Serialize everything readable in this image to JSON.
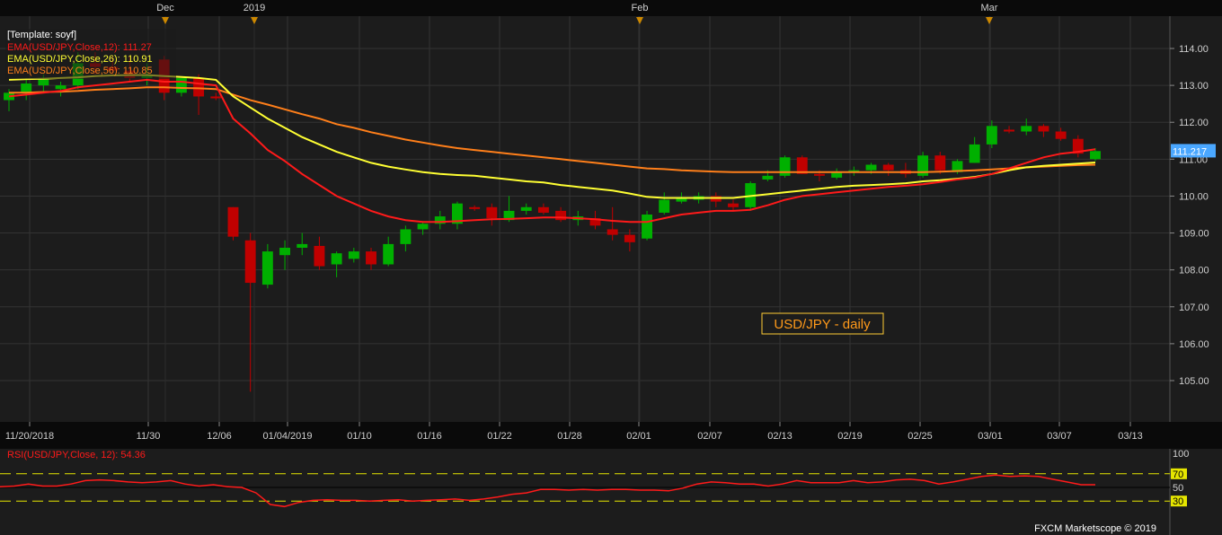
{
  "main_chart": {
    "chart_data": {
      "type": "candlestick",
      "symbol": "USD/JPY",
      "title": "USD/JPY - daily",
      "template": "[Template: soyf]",
      "price_label": "111.217",
      "ylim": [
        104.2,
        114.5
      ],
      "yticks": [
        "114.00",
        "113.00",
        "112.00",
        "111.00",
        "110.00",
        "109.00",
        "108.00",
        "107.00",
        "106.00",
        "105.00"
      ],
      "x_top_markers": [
        "Dec",
        "2019",
        "Feb",
        "Mar"
      ],
      "x_bottom_labels": [
        "11/20/2018",
        "11/30",
        "12/06",
        "01/04/2019",
        "01/10",
        "01/16",
        "01/22",
        "01/28",
        "02/01",
        "02/07",
        "02/13",
        "02/19",
        "02/25",
        "03/01",
        "03/07",
        "03/13"
      ],
      "candles": [
        {
          "o": 112.6,
          "h": 112.9,
          "l": 112.3,
          "c": 112.8
        },
        {
          "o": 112.8,
          "h": 113.2,
          "l": 112.6,
          "c": 113.05
        },
        {
          "o": 113.0,
          "h": 113.3,
          "l": 112.8,
          "c": 113.2
        },
        {
          "o": 112.9,
          "h": 113.1,
          "l": 112.7,
          "c": 113.0
        },
        {
          "o": 113.0,
          "h": 113.9,
          "l": 112.9,
          "c": 113.6
        },
        {
          "o": 113.6,
          "h": 113.9,
          "l": 113.3,
          "c": 113.5
        },
        {
          "o": 113.5,
          "h": 113.8,
          "l": 113.3,
          "c": 113.4
        },
        {
          "o": 113.4,
          "h": 113.8,
          "l": 113.1,
          "c": 113.2
        },
        {
          "o": 113.2,
          "h": 113.6,
          "l": 113.0,
          "c": 113.3
        },
        {
          "o": 113.7,
          "h": 113.8,
          "l": 112.6,
          "c": 112.8
        },
        {
          "o": 112.8,
          "h": 113.2,
          "l": 112.7,
          "c": 113.2
        },
        {
          "o": 113.2,
          "h": 113.3,
          "l": 112.2,
          "c": 112.7
        },
        {
          "o": 112.7,
          "h": 112.8,
          "l": 112.6,
          "c": 112.65
        },
        {
          "o": 109.7,
          "h": 109.7,
          "l": 108.8,
          "c": 108.9
        },
        {
          "o": 108.8,
          "h": 109.0,
          "l": 104.7,
          "c": 107.65
        },
        {
          "o": 107.6,
          "h": 108.7,
          "l": 107.5,
          "c": 108.5
        },
        {
          "o": 108.4,
          "h": 108.8,
          "l": 108.0,
          "c": 108.6
        },
        {
          "o": 108.6,
          "h": 109.0,
          "l": 108.4,
          "c": 108.7
        },
        {
          "o": 108.65,
          "h": 108.9,
          "l": 108.0,
          "c": 108.1
        },
        {
          "o": 108.15,
          "h": 108.5,
          "l": 107.8,
          "c": 108.45
        },
        {
          "o": 108.3,
          "h": 108.6,
          "l": 108.2,
          "c": 108.5
        },
        {
          "o": 108.5,
          "h": 108.6,
          "l": 108.0,
          "c": 108.15
        },
        {
          "o": 108.15,
          "h": 108.9,
          "l": 108.1,
          "c": 108.7
        },
        {
          "o": 108.7,
          "h": 109.2,
          "l": 108.5,
          "c": 109.1
        },
        {
          "o": 109.1,
          "h": 109.3,
          "l": 108.95,
          "c": 109.25
        },
        {
          "o": 109.25,
          "h": 109.6,
          "l": 109.1,
          "c": 109.45
        },
        {
          "o": 109.25,
          "h": 109.85,
          "l": 109.1,
          "c": 109.8
        },
        {
          "o": 109.7,
          "h": 109.75,
          "l": 109.6,
          "c": 109.65
        },
        {
          "o": 109.7,
          "h": 109.8,
          "l": 109.2,
          "c": 109.4
        },
        {
          "o": 109.35,
          "h": 110.0,
          "l": 109.3,
          "c": 109.6
        },
        {
          "o": 109.6,
          "h": 109.8,
          "l": 109.5,
          "c": 109.7
        },
        {
          "o": 109.7,
          "h": 109.8,
          "l": 109.5,
          "c": 109.55
        },
        {
          "o": 109.6,
          "h": 109.7,
          "l": 109.3,
          "c": 109.35
        },
        {
          "o": 109.35,
          "h": 109.6,
          "l": 109.2,
          "c": 109.45
        },
        {
          "o": 109.4,
          "h": 109.6,
          "l": 109.1,
          "c": 109.2
        },
        {
          "o": 109.1,
          "h": 109.7,
          "l": 108.8,
          "c": 108.95
        },
        {
          "o": 108.95,
          "h": 109.1,
          "l": 108.5,
          "c": 108.75
        },
        {
          "o": 108.85,
          "h": 109.6,
          "l": 108.8,
          "c": 109.5
        },
        {
          "o": 109.55,
          "h": 110.1,
          "l": 109.5,
          "c": 109.9
        },
        {
          "o": 109.85,
          "h": 110.1,
          "l": 109.8,
          "c": 109.95
        },
        {
          "o": 109.9,
          "h": 110.1,
          "l": 109.8,
          "c": 110.0
        },
        {
          "o": 110.0,
          "h": 110.1,
          "l": 109.7,
          "c": 109.85
        },
        {
          "o": 109.8,
          "h": 109.9,
          "l": 109.6,
          "c": 109.7
        },
        {
          "o": 109.7,
          "h": 110.4,
          "l": 109.6,
          "c": 110.35
        },
        {
          "o": 110.45,
          "h": 110.7,
          "l": 110.4,
          "c": 110.55
        },
        {
          "o": 110.55,
          "h": 111.1,
          "l": 110.5,
          "c": 111.05
        },
        {
          "o": 111.05,
          "h": 111.1,
          "l": 110.6,
          "c": 110.6
        },
        {
          "o": 110.6,
          "h": 110.7,
          "l": 110.4,
          "c": 110.55
        },
        {
          "o": 110.5,
          "h": 110.75,
          "l": 110.45,
          "c": 110.65
        },
        {
          "o": 110.65,
          "h": 110.8,
          "l": 110.55,
          "c": 110.7
        },
        {
          "o": 110.7,
          "h": 110.9,
          "l": 110.6,
          "c": 110.85
        },
        {
          "o": 110.85,
          "h": 110.9,
          "l": 110.55,
          "c": 110.7
        },
        {
          "o": 110.7,
          "h": 110.9,
          "l": 110.5,
          "c": 110.6
        },
        {
          "o": 110.55,
          "h": 111.2,
          "l": 110.5,
          "c": 111.1
        },
        {
          "o": 111.1,
          "h": 111.2,
          "l": 110.6,
          "c": 110.7
        },
        {
          "o": 110.65,
          "h": 111.0,
          "l": 110.6,
          "c": 110.95
        },
        {
          "o": 110.9,
          "h": 111.6,
          "l": 110.9,
          "c": 111.4
        },
        {
          "o": 111.4,
          "h": 112.05,
          "l": 111.3,
          "c": 111.9
        },
        {
          "o": 111.8,
          "h": 111.9,
          "l": 111.7,
          "c": 111.75
        },
        {
          "o": 111.75,
          "h": 112.1,
          "l": 111.65,
          "c": 111.9
        },
        {
          "o": 111.9,
          "h": 111.95,
          "l": 111.6,
          "c": 111.75
        },
        {
          "o": 111.75,
          "h": 111.85,
          "l": 111.5,
          "c": 111.55
        },
        {
          "o": 111.55,
          "h": 111.65,
          "l": 111.05,
          "c": 111.15
        },
        {
          "o": 111.0,
          "h": 111.3,
          "l": 110.95,
          "c": 111.22
        }
      ],
      "series": [
        {
          "name": "EMA(USD/JPY,Close,12)",
          "legend_value": "111.27",
          "color": "#ff1a1a",
          "values": [
            112.7,
            112.75,
            112.8,
            112.85,
            112.95,
            113.0,
            113.05,
            113.1,
            113.15,
            113.1,
            113.1,
            113.05,
            113.0,
            112.1,
            111.7,
            111.25,
            110.95,
            110.6,
            110.3,
            110.0,
            109.8,
            109.6,
            109.45,
            109.35,
            109.3,
            109.3,
            109.32,
            109.35,
            109.37,
            109.38,
            109.4,
            109.42,
            109.42,
            109.4,
            109.37,
            109.33,
            109.3,
            109.3,
            109.4,
            109.5,
            109.55,
            109.6,
            109.6,
            109.63,
            109.75,
            109.9,
            110.0,
            110.05,
            110.1,
            110.15,
            110.2,
            110.25,
            110.28,
            110.32,
            110.38,
            110.45,
            110.5,
            110.6,
            110.75,
            110.9,
            111.05,
            111.15,
            111.2,
            111.27
          ]
        },
        {
          "name": "EMA(USD/JPY,Close,26)",
          "legend_value": "110.91",
          "color": "#ffff33",
          "values": [
            113.15,
            113.17,
            113.18,
            113.2,
            113.22,
            113.25,
            113.27,
            113.28,
            113.28,
            113.25,
            113.23,
            113.2,
            113.15,
            112.7,
            112.4,
            112.1,
            111.85,
            111.6,
            111.4,
            111.2,
            111.05,
            110.9,
            110.8,
            110.72,
            110.65,
            110.6,
            110.57,
            110.55,
            110.5,
            110.45,
            110.4,
            110.37,
            110.3,
            110.25,
            110.2,
            110.15,
            110.07,
            109.98,
            109.95,
            109.95,
            109.95,
            109.95,
            109.95,
            110.0,
            110.05,
            110.1,
            110.15,
            110.2,
            110.25,
            110.28,
            110.3,
            110.32,
            110.35,
            110.4,
            110.43,
            110.47,
            110.52,
            110.6,
            110.7,
            110.78,
            110.82,
            110.85,
            110.88,
            110.91
          ]
        },
        {
          "name": "EMA(USD/JPY,Close,56)",
          "legend_value": "110.85",
          "color": "#ff7f1a",
          "values": [
            112.8,
            112.8,
            112.82,
            112.83,
            112.85,
            112.88,
            112.9,
            112.92,
            112.95,
            112.95,
            112.93,
            112.92,
            112.9,
            112.75,
            112.6,
            112.48,
            112.35,
            112.22,
            112.1,
            111.95,
            111.85,
            111.73,
            111.63,
            111.53,
            111.45,
            111.37,
            111.3,
            111.25,
            111.2,
            111.15,
            111.1,
            111.05,
            111.0,
            110.95,
            110.9,
            110.85,
            110.8,
            110.75,
            110.73,
            110.7,
            110.68,
            110.66,
            110.65,
            110.65,
            110.65,
            110.65,
            110.65,
            110.65,
            110.65,
            110.65,
            110.65,
            110.65,
            110.65,
            110.65,
            110.66,
            110.68,
            110.7,
            110.72,
            110.75,
            110.78,
            110.8,
            110.82,
            110.84,
            110.85
          ]
        }
      ],
      "ema_x_last": 1219
    }
  },
  "rsi_chart": {
    "chart_data": {
      "type": "line",
      "title": "RSI(USD/JPY,Close, 12): 54.36",
      "ylim": [
        0,
        100
      ],
      "yticks": [
        "100",
        "70",
        "50",
        "30"
      ],
      "levels": [
        70,
        30
      ],
      "series": [
        {
          "name": "RSI(USD/JPY,Close, 12)",
          "color": "#ff1a1a",
          "values": [
            51,
            52,
            55,
            52,
            52,
            55,
            60,
            61,
            60,
            58,
            57,
            58,
            60,
            55,
            52,
            54,
            51,
            50,
            42,
            25,
            22,
            28,
            31,
            32,
            31,
            31,
            30,
            31,
            32,
            30,
            31,
            32,
            33,
            31,
            33,
            36,
            40,
            42,
            47,
            47,
            46,
            47,
            46,
            47,
            47,
            46,
            46,
            45,
            49,
            55,
            58,
            57,
            55,
            55,
            52,
            55,
            60,
            57,
            57,
            57,
            60,
            57,
            58,
            61,
            62,
            60,
            55,
            58,
            62,
            66,
            68,
            66,
            67,
            66,
            62,
            58,
            54,
            54
          ]
        }
      ]
    }
  },
  "footer": {
    "copyright": "FXCM Marketscope © 2019"
  },
  "colors": {
    "background": "#1c1c1c",
    "frame": "#0a0a0a",
    "grid": "#333333",
    "bull": "#00b000",
    "bear": "#c00000",
    "title_border": "#ffcc33",
    "title_text": "#ff9a1a",
    "price_label_bg": "#4aa7ff",
    "marker": "#cc8800"
  }
}
